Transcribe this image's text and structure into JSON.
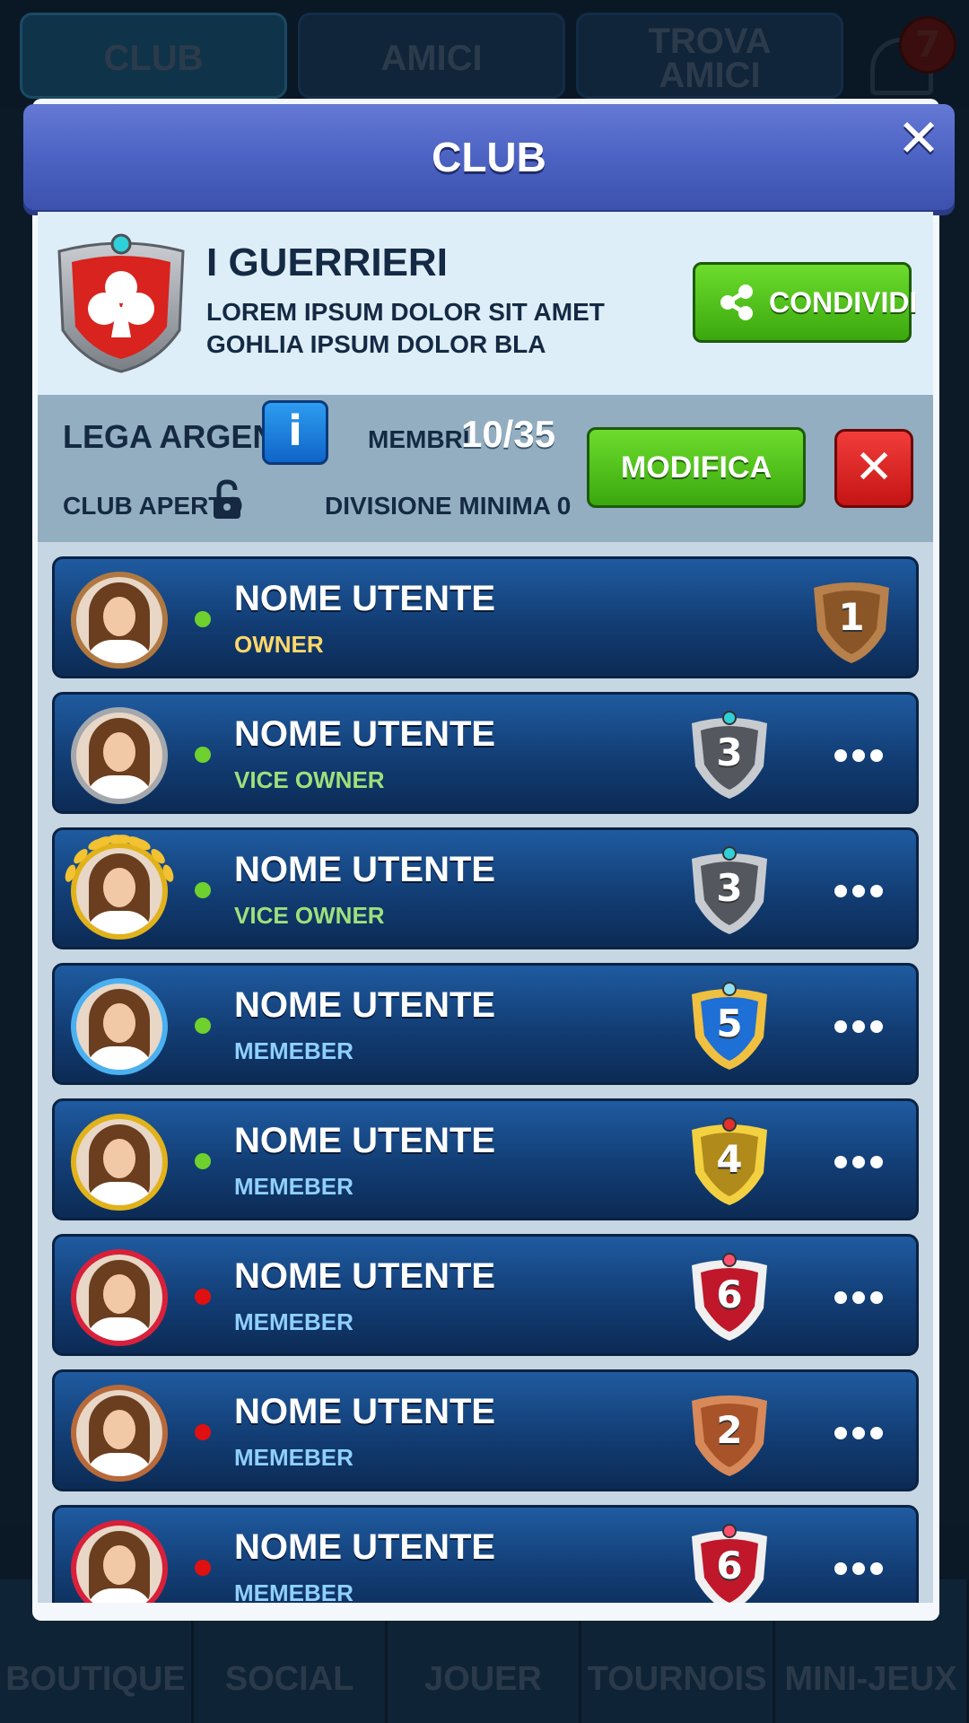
{
  "background": {
    "tabs": [
      "CLUB",
      "AMICI",
      "TROVA AMICI"
    ],
    "notification_count": "7",
    "bottom_nav": [
      "BOUTIQUE",
      "SOCIAL",
      "JOUER",
      "TOURNOIS",
      "MINI-JEUX"
    ]
  },
  "modal": {
    "title": "CLUB",
    "close_icon": "close-x-icon"
  },
  "club": {
    "crest_icon": "club-suit-shield-icon",
    "name": "I GUERRIERI",
    "description": "LOREM IPSUM DOLOR SIT AMET GOHLIA IPSUM DOLOR BLA",
    "share_label": "CONDIVIDI",
    "league_label": "LEGA ARGENTO",
    "info_label": "i",
    "members_label": "MEMBRI",
    "members_value": "10/35",
    "open_label": "CLUB APERTO",
    "min_division_label": "DIVISIONE MINIMA 0",
    "edit_label": "MODIFICA",
    "leave_icon": "close-x-icon"
  },
  "colors": {
    "header": "#4d63c3",
    "green_button": "#3aa80e",
    "red_button": "#c41414",
    "row_bg": "#123d74",
    "online": "#6fd12e",
    "offline": "#e01010"
  },
  "members": [
    {
      "name": "NOME UTENTE",
      "role": "OWNER",
      "role_color": "#ffd86a",
      "online": true,
      "avatar_ring": "#b07840",
      "laurel": false,
      "division": "1",
      "badge": "bronze",
      "more": false
    },
    {
      "name": "NOME UTENTE",
      "role": "VICE OWNER",
      "role_color": "#9fe07a",
      "online": true,
      "avatar_ring": "#a4a8ad",
      "laurel": false,
      "division": "3",
      "badge": "silver",
      "more": true
    },
    {
      "name": "NOME UTENTE",
      "role": "VICE OWNER",
      "role_color": "#9fe07a",
      "online": true,
      "avatar_ring": "#e2b21a",
      "laurel": true,
      "division": "3",
      "badge": "silver",
      "more": true
    },
    {
      "name": "NOME UTENTE",
      "role": "MEMEBER",
      "role_color": "#8fd0ff",
      "online": true,
      "avatar_ring": "#4ab0f0",
      "laurel": false,
      "division": "5",
      "badge": "blue",
      "more": true
    },
    {
      "name": "NOME UTENTE",
      "role": "MEMEBER",
      "role_color": "#8fd0ff",
      "online": true,
      "avatar_ring": "#e2b21a",
      "laurel": false,
      "division": "4",
      "badge": "gold",
      "more": true
    },
    {
      "name": "NOME UTENTE",
      "role": "MEMEBER",
      "role_color": "#8fd0ff",
      "online": false,
      "avatar_ring": "#d8203a",
      "laurel": false,
      "division": "6",
      "badge": "ruby",
      "more": true
    },
    {
      "name": "NOME UTENTE",
      "role": "MEMEBER",
      "role_color": "#8fd0ff",
      "online": false,
      "avatar_ring": "#b86a3a",
      "laurel": false,
      "division": "2",
      "badge": "copper",
      "more": true
    },
    {
      "name": "NOME UTENTE",
      "role": "MEMEBER",
      "role_color": "#8fd0ff",
      "online": false,
      "avatar_ring": "#d8203a",
      "laurel": false,
      "division": "6",
      "badge": "ruby",
      "more": true
    }
  ]
}
